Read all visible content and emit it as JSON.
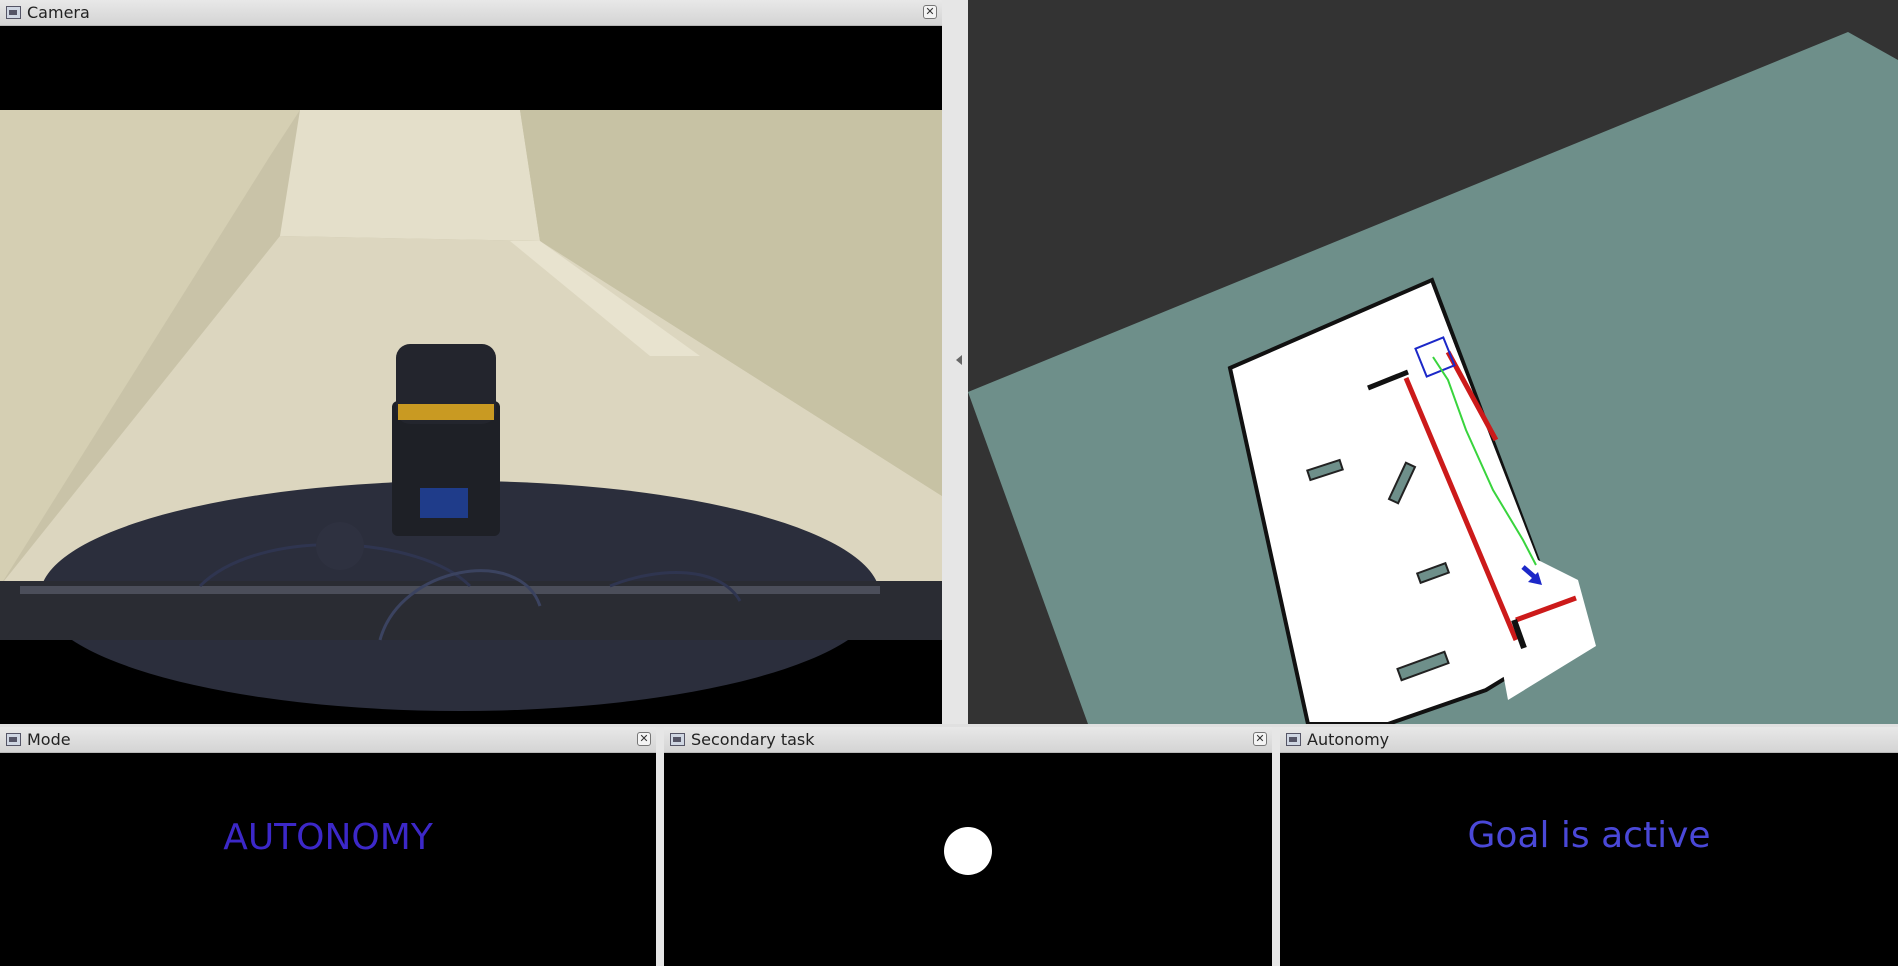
{
  "panels": {
    "camera": {
      "title": "Camera",
      "close": "✕"
    },
    "mode": {
      "title": "Mode",
      "close": "✕",
      "text": "AUTONOMY",
      "text_color": "#3c28c8"
    },
    "secondary": {
      "title": "Secondary task",
      "close": "✕"
    },
    "autonomy": {
      "title": "Autonomy",
      "text": "Goal is active",
      "text_color": "#4a48d8"
    }
  },
  "colors": {
    "map_background": "#333333",
    "map_unknown": "#6e8f8a",
    "map_free": "#ffffff",
    "path": "#39d43d",
    "obstacle_edge": "#cc1a1a",
    "goal_arrow": "#1c28c8"
  },
  "icons": [
    "window-icon",
    "close-icon",
    "splitter-arrow-icon"
  ]
}
